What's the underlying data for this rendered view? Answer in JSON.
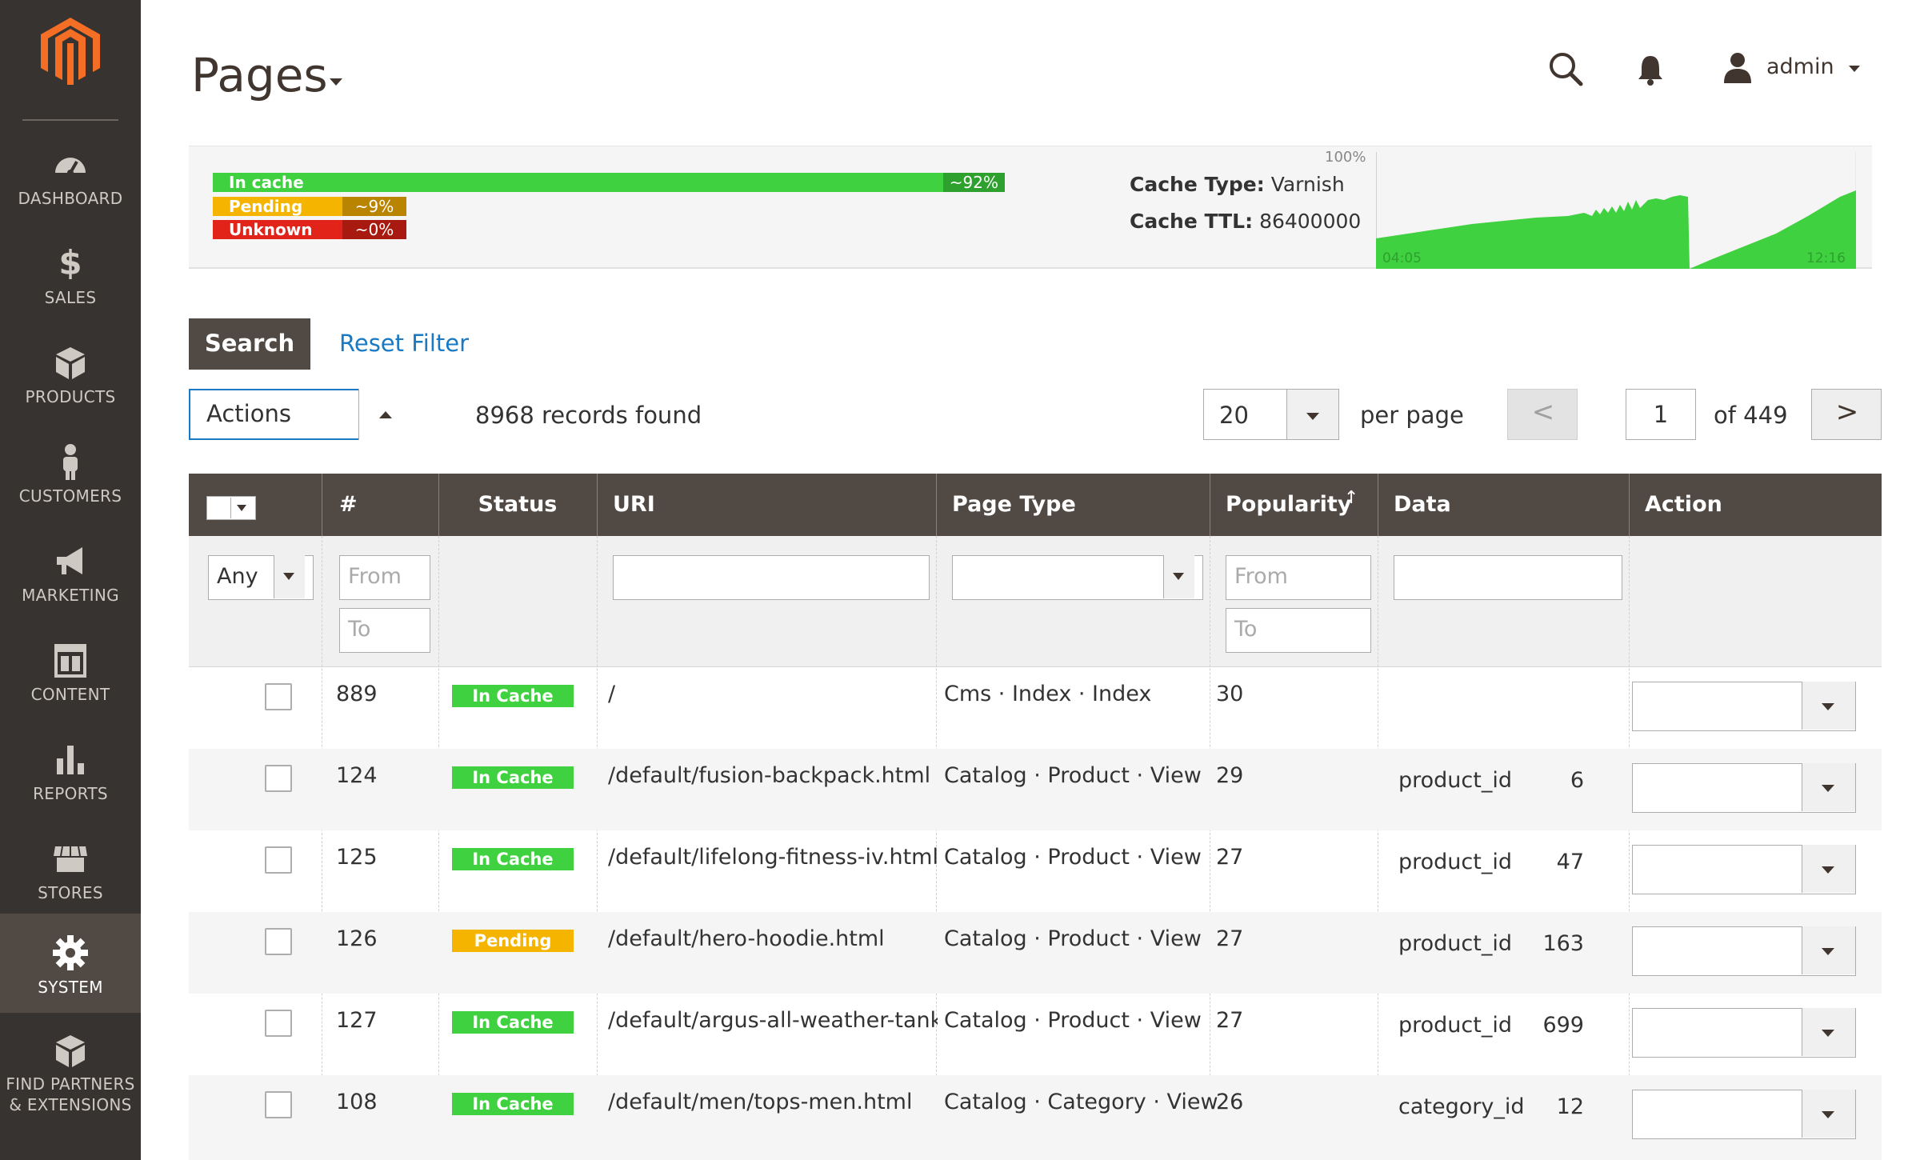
{
  "sidebar": {
    "items": [
      {
        "label": "DASHBOARD",
        "icon": "dashboard-icon"
      },
      {
        "label": "SALES",
        "icon": "dollar-icon"
      },
      {
        "label": "PRODUCTS",
        "icon": "box-icon"
      },
      {
        "label": "CUSTOMERS",
        "icon": "person-icon"
      },
      {
        "label": "MARKETING",
        "icon": "megaphone-icon"
      },
      {
        "label": "CONTENT",
        "icon": "layout-icon"
      },
      {
        "label": "REPORTS",
        "icon": "bar-chart-icon"
      },
      {
        "label": "STORES",
        "icon": "storefront-icon"
      },
      {
        "label": "SYSTEM",
        "icon": "gear-icon",
        "active": true
      },
      {
        "label_line1": "FIND PARTNERS",
        "label_line2": "& EXTENSIONS",
        "icon": "blocks-icon"
      }
    ]
  },
  "header": {
    "title": "Pages",
    "user": "admin"
  },
  "cache_status": {
    "in_cache": {
      "label": "In cache",
      "pct": "~92%",
      "fraction": 0.92
    },
    "pending": {
      "label": "Pending",
      "pct": "~9%",
      "fraction": 0.09
    },
    "unknown": {
      "label": "Unknown",
      "pct": "~0%",
      "fraction": 0.0
    },
    "cache_type_label": "Cache Type:",
    "cache_type": "Varnish",
    "cache_ttl_label": "Cache TTL:",
    "cache_ttl": "86400000",
    "graph": {
      "max_label": "100%",
      "start_time": "04:05",
      "end_time": "12:16",
      "color": "#3fd13f"
    }
  },
  "filters": {
    "search_label": "Search",
    "reset_label": "Reset Filter"
  },
  "toolbar": {
    "actions_label": "Actions",
    "records_found": "8968 records found",
    "per_page_value": "20",
    "per_page_label": "per page",
    "prev_label": "<",
    "current_page": "1",
    "of_pages": "of 449",
    "next_label": ">"
  },
  "grid": {
    "columns": [
      "#",
      "Status",
      "URI",
      "Page Type",
      "Popularity",
      "Data",
      "Action"
    ],
    "sort_indicator": "↑",
    "filter_any": "Any",
    "filter_from": "From",
    "filter_to": "To",
    "rows": [
      {
        "id": "889",
        "status": "In Cache",
        "uri": "/",
        "page_type": "Cms · Index · Index",
        "popularity": "30",
        "data_key": "",
        "data_value": ""
      },
      {
        "id": "124",
        "status": "In Cache",
        "uri": "/default/fusion-backpack.html",
        "page_type": "Catalog · Product · View",
        "popularity": "29",
        "data_key": "product_id",
        "data_value": "6"
      },
      {
        "id": "125",
        "status": "In Cache",
        "uri": "/default/lifelong-fitness-iv.html",
        "page_type": "Catalog · Product · View",
        "popularity": "27",
        "data_key": "product_id",
        "data_value": "47"
      },
      {
        "id": "126",
        "status": "Pending",
        "uri": "/default/hero-hoodie.html",
        "page_type": "Catalog · Product · View",
        "popularity": "27",
        "data_key": "product_id",
        "data_value": "163"
      },
      {
        "id": "127",
        "status": "In Cache",
        "uri": "/default/argus-all-weather-tank.html",
        "page_type": "Catalog · Product · View",
        "popularity": "27",
        "data_key": "product_id",
        "data_value": "699"
      },
      {
        "id": "108",
        "status": "In Cache",
        "uri": "/default/men/tops-men.html",
        "page_type": "Catalog · Category · View",
        "popularity": "26",
        "data_key": "category_id",
        "data_value": "12"
      }
    ]
  },
  "colors": {
    "sidebar_bg": "#373330",
    "sidebar_active": "#514943",
    "logo": "#f46f25",
    "header_bg": "#514943",
    "link": "#1979c3",
    "in_cache": "#3fd13f",
    "pending": "#f4b400",
    "unknown": "#e2231a"
  }
}
